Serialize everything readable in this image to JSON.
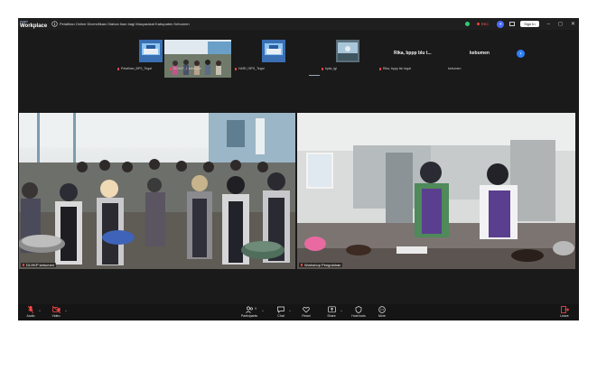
{
  "app": {
    "logo_top": "zoom",
    "logo_main": "Workplace",
    "meeting_title": "Pelatihan Online Diversifikasi Olahan Ikan bagi Masyarakat Kabupaten Kebumen"
  },
  "titlebar": {
    "rec_label": "REC",
    "sign_in_label": "Sign In",
    "minimize": "–",
    "maximize": "◻",
    "close": "✕"
  },
  "gallery_strip": {
    "tiles": [
      {
        "label": "Pelatihan_BPS_Tegal"
      },
      {
        "label": "DI-HKP_1 kebumen"
      },
      {
        "label": "HARI | BPS_Tegal"
      },
      {
        "label": "bpsk_tgl"
      },
      {
        "name": "Rika, bppp blu t...",
        "label": "Rika, bppp blu tegal"
      },
      {
        "name": "kebumen",
        "label": "kebumen"
      }
    ],
    "next_icon": "›"
  },
  "videos": {
    "left_name": "DI-HKP kebumen",
    "right_name": "Workshop Pengolahan"
  },
  "toolbar": {
    "audio": "Audio",
    "video": "Video",
    "participants": "Participants",
    "participants_count": "9",
    "chat": "Chat",
    "react": "React",
    "share": "Share",
    "host_tools": "Host tools",
    "more": "More",
    "leave": "Leave"
  },
  "colors": {
    "background": "#1a1a1a",
    "active_speaker_border": "#3ce07a",
    "muted_red": "#ff4a4a",
    "accent_blue": "#2d7ff9"
  }
}
